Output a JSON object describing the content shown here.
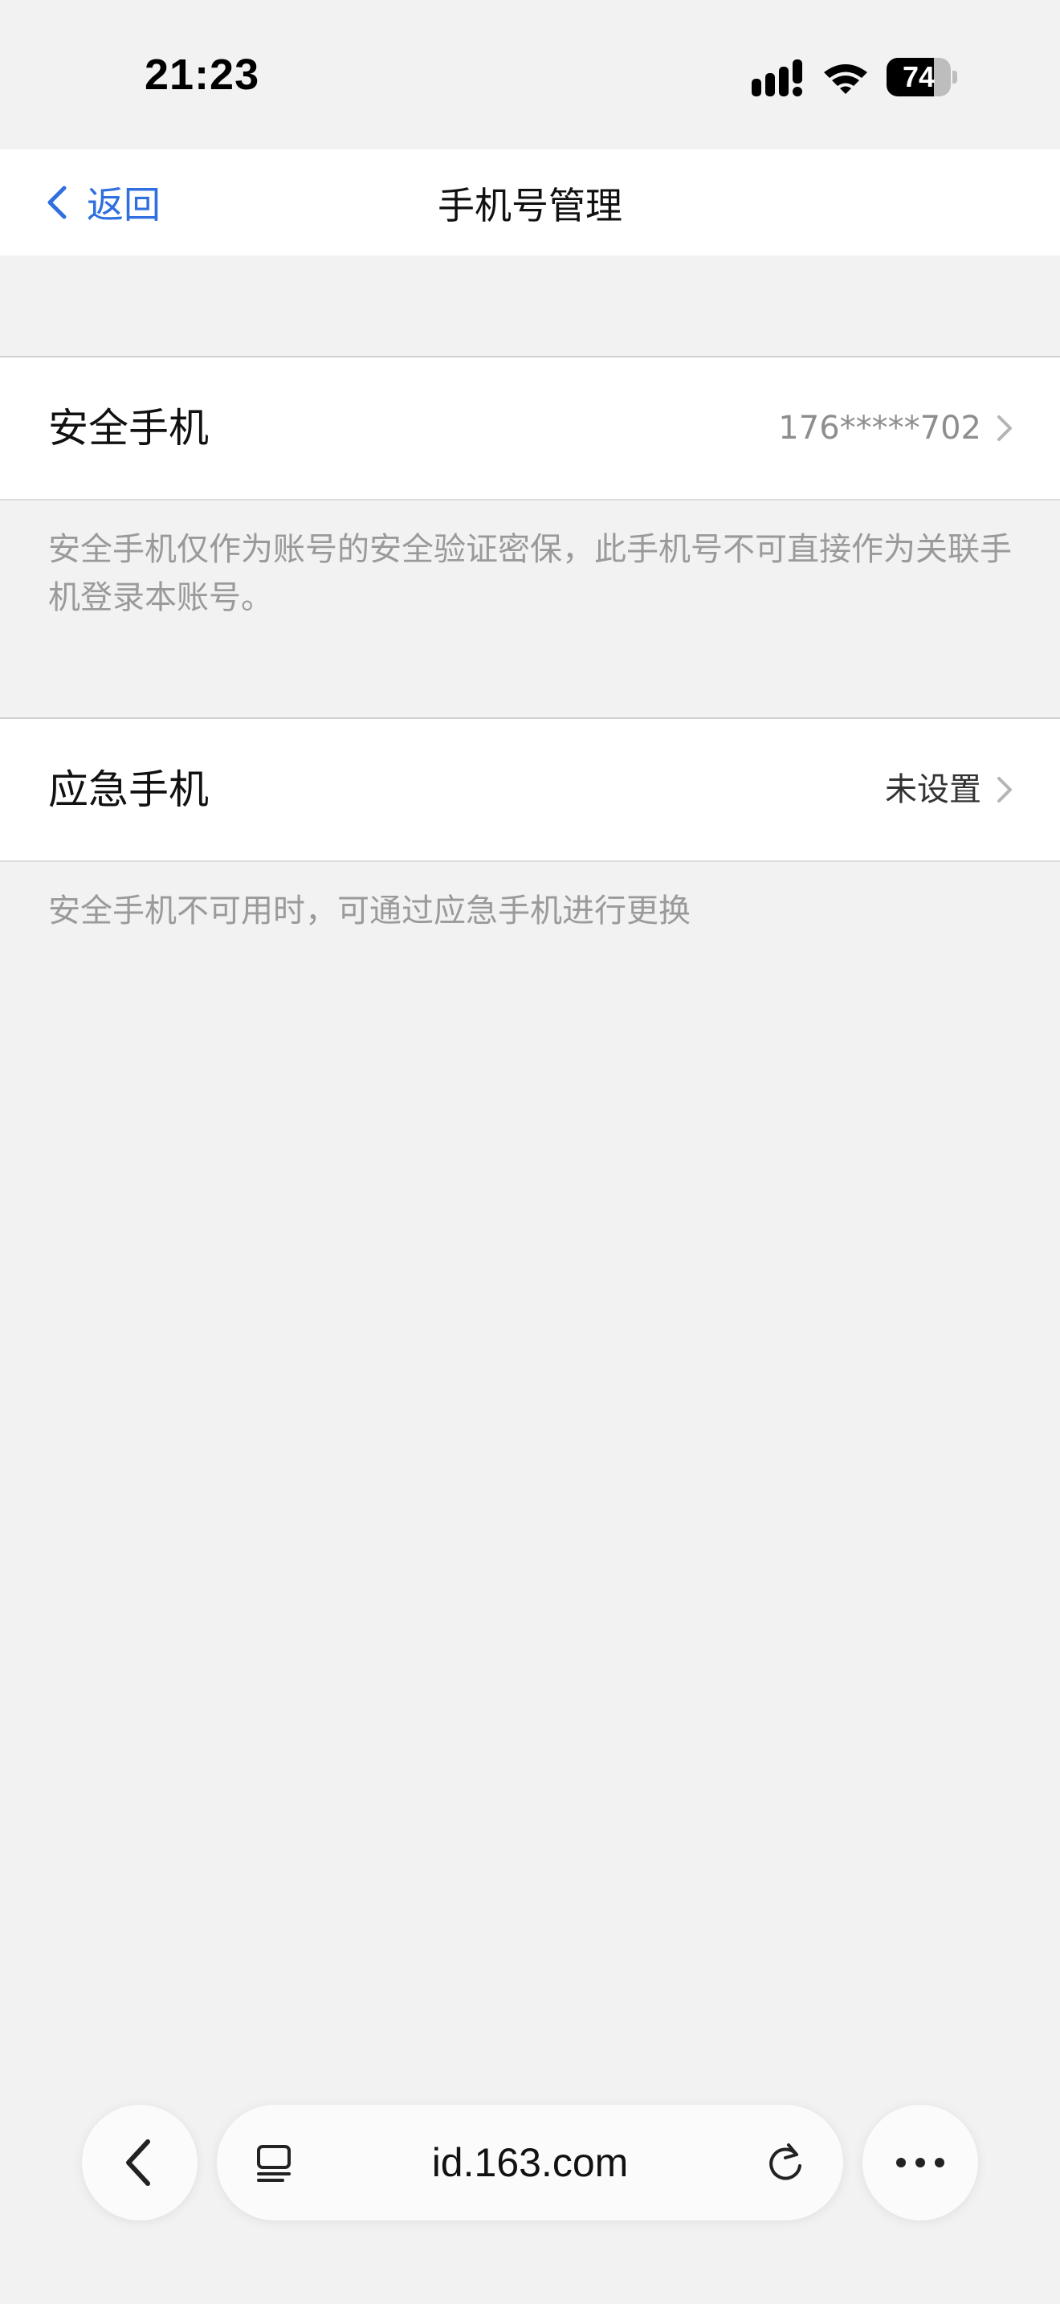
{
  "status_bar": {
    "time": "21:23",
    "battery": "74",
    "battery_level": 0.74,
    "icons": [
      "signal-icon",
      "wifi-icon",
      "battery-icon"
    ]
  },
  "nav": {
    "back_label": "返回",
    "title": "手机号管理",
    "back_icon": "chevron-left-icon",
    "accent_color": "#2f6fe0"
  },
  "security_phone": {
    "label": "安全手机",
    "value": "176*****702",
    "value_color": "#8e8e8e",
    "note": "安全手机仅作为账号的安全验证密保，此手机号不可直接作为关联手机登录本账号。"
  },
  "emergency_phone": {
    "label": "应急手机",
    "value": "未设置",
    "value_color": "#333333",
    "note": "安全手机不可用时，可通过应急手机进行更换"
  },
  "browser": {
    "url": "id.163.com",
    "icons": [
      "back-icon",
      "tabs-icon",
      "reload-icon",
      "more-icon"
    ]
  }
}
